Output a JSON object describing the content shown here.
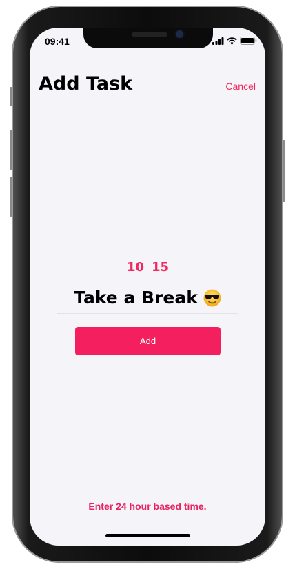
{
  "status_bar": {
    "time": "09:41",
    "icons": [
      "signal-icon",
      "wifi-icon",
      "battery-icon"
    ]
  },
  "header": {
    "title": "Add Task",
    "cancel_label": "Cancel"
  },
  "form": {
    "hours": "10",
    "minutes": "15",
    "task_name": "Take a Break",
    "task_emoji": "smiling-face-with-sunglasses",
    "add_label": "Add"
  },
  "footer": {
    "hint": "Enter 24 hour based time."
  },
  "colors": {
    "accent": "#f41f5f",
    "background": "#f4f4f9"
  }
}
